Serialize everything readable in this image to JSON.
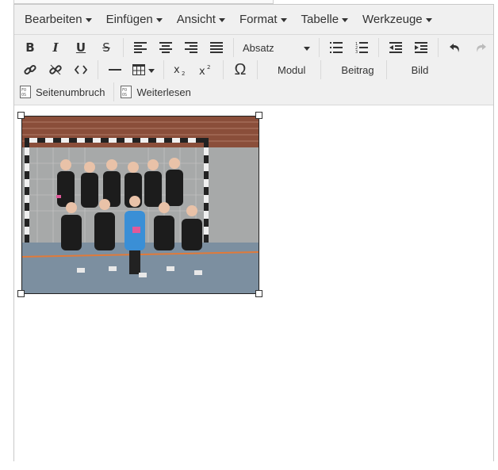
{
  "menubar": {
    "items": [
      {
        "label": "Bearbeiten",
        "name": "menu-bearbeiten"
      },
      {
        "label": "Einfügen",
        "name": "menu-einfuegen"
      },
      {
        "label": "Ansicht",
        "name": "menu-ansicht"
      },
      {
        "label": "Format",
        "name": "menu-format"
      },
      {
        "label": "Tabelle",
        "name": "menu-tabelle"
      },
      {
        "label": "Werkzeuge",
        "name": "menu-werkzeuge"
      }
    ]
  },
  "toolbar": {
    "bold": "B",
    "italic": "I",
    "underline": "U",
    "strikethrough": "S",
    "block_format": "Absatz",
    "omega": "Ω",
    "modul_label": "Modul",
    "beitrag_label": "Beitrag",
    "bild_label": "Bild",
    "pagebreak_label": "Seitenumbruch",
    "readmore_label": "Weiterlesen"
  },
  "image": {
    "alt": "Mannschaftsfoto Handball-Damen in der Halle"
  }
}
